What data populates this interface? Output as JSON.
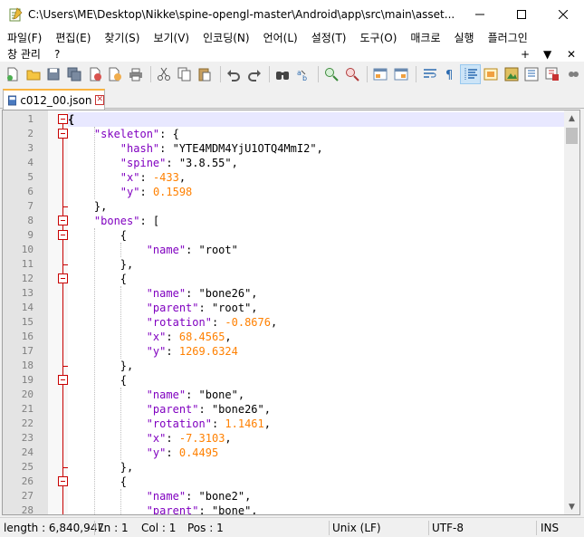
{
  "window": {
    "title": "C:\\Users\\ME\\Desktop\\Nikke\\spine-opengl-master\\Android\\app\\src\\main\\asset..."
  },
  "menu": {
    "row1": [
      "파일(F)",
      "편집(E)",
      "찾기(S)",
      "보기(V)",
      "인코딩(N)",
      "언어(L)",
      "설정(T)",
      "도구(O)",
      "매크로",
      "실행",
      "플러그인"
    ],
    "row2": [
      "창 관리",
      "?"
    ],
    "right_controls": [
      "+",
      "▼",
      "✕"
    ]
  },
  "toolbar": {
    "buttons": [
      "new-file",
      "open-file",
      "save",
      "save-all",
      "close",
      "close-all",
      "print",
      "cut",
      "copy",
      "paste",
      "undo",
      "redo",
      "find",
      "replace",
      "zoom-in",
      "zoom-out",
      "sync-vertical",
      "sync-horizontal",
      "word-wrap",
      "show-all-chars",
      "indent-guide",
      "document-map",
      "function-list",
      "folder-workspace",
      "monitoring"
    ]
  },
  "tab": {
    "label": "c012_00.json"
  },
  "editor": {
    "lines": [
      {
        "n": "1",
        "t": [
          [
            "p",
            "{"
          ]
        ]
      },
      {
        "n": "2",
        "t": [
          [
            "s",
            "    "
          ],
          [
            "k",
            "\"skeleton\""
          ],
          [
            "s",
            ": {"
          ]
        ]
      },
      {
        "n": "3",
        "t": [
          [
            "s",
            "        "
          ],
          [
            "k",
            "\"hash\""
          ],
          [
            "s",
            ": \"YTE4MDM4YjU1OTQ4MmI2\","
          ]
        ]
      },
      {
        "n": "4",
        "t": [
          [
            "s",
            "        "
          ],
          [
            "k",
            "\"spine\""
          ],
          [
            "s",
            ": \"3.8.55\","
          ]
        ]
      },
      {
        "n": "5",
        "t": [
          [
            "s",
            "        "
          ],
          [
            "k",
            "\"x\""
          ],
          [
            "s",
            ": "
          ],
          [
            "n",
            "-433"
          ],
          [
            "s",
            ","
          ]
        ]
      },
      {
        "n": "6",
        "t": [
          [
            "s",
            "        "
          ],
          [
            "k",
            "\"y\""
          ],
          [
            "s",
            ": "
          ],
          [
            "n",
            "0.1598"
          ]
        ]
      },
      {
        "n": "7",
        "t": [
          [
            "s",
            "    },"
          ]
        ]
      },
      {
        "n": "8",
        "t": [
          [
            "s",
            "    "
          ],
          [
            "k",
            "\"bones\""
          ],
          [
            "s",
            ": ["
          ]
        ]
      },
      {
        "n": "9",
        "t": [
          [
            "s",
            "        {"
          ]
        ]
      },
      {
        "n": "10",
        "t": [
          [
            "s",
            "            "
          ],
          [
            "k",
            "\"name\""
          ],
          [
            "s",
            ": \"root\""
          ]
        ]
      },
      {
        "n": "11",
        "t": [
          [
            "s",
            "        },"
          ]
        ]
      },
      {
        "n": "12",
        "t": [
          [
            "s",
            "        {"
          ]
        ]
      },
      {
        "n": "13",
        "t": [
          [
            "s",
            "            "
          ],
          [
            "k",
            "\"name\""
          ],
          [
            "s",
            ": \"bone26\","
          ]
        ]
      },
      {
        "n": "14",
        "t": [
          [
            "s",
            "            "
          ],
          [
            "k",
            "\"parent\""
          ],
          [
            "s",
            ": \"root\","
          ]
        ]
      },
      {
        "n": "15",
        "t": [
          [
            "s",
            "            "
          ],
          [
            "k",
            "\"rotation\""
          ],
          [
            "s",
            ": "
          ],
          [
            "n",
            "-0.8676"
          ],
          [
            "s",
            ","
          ]
        ]
      },
      {
        "n": "16",
        "t": [
          [
            "s",
            "            "
          ],
          [
            "k",
            "\"x\""
          ],
          [
            "s",
            ": "
          ],
          [
            "n",
            "68.4565"
          ],
          [
            "s",
            ","
          ]
        ]
      },
      {
        "n": "17",
        "t": [
          [
            "s",
            "            "
          ],
          [
            "k",
            "\"y\""
          ],
          [
            "s",
            ": "
          ],
          [
            "n",
            "1269.6324"
          ]
        ]
      },
      {
        "n": "18",
        "t": [
          [
            "s",
            "        },"
          ]
        ]
      },
      {
        "n": "19",
        "t": [
          [
            "s",
            "        {"
          ]
        ]
      },
      {
        "n": "20",
        "t": [
          [
            "s",
            "            "
          ],
          [
            "k",
            "\"name\""
          ],
          [
            "s",
            ": \"bone\","
          ]
        ]
      },
      {
        "n": "21",
        "t": [
          [
            "s",
            "            "
          ],
          [
            "k",
            "\"parent\""
          ],
          [
            "s",
            ": \"bone26\","
          ]
        ]
      },
      {
        "n": "22",
        "t": [
          [
            "s",
            "            "
          ],
          [
            "k",
            "\"rotation\""
          ],
          [
            "s",
            ": "
          ],
          [
            "n",
            "1.1461"
          ],
          [
            "s",
            ","
          ]
        ]
      },
      {
        "n": "23",
        "t": [
          [
            "s",
            "            "
          ],
          [
            "k",
            "\"x\""
          ],
          [
            "s",
            ": "
          ],
          [
            "n",
            "-7.3103"
          ],
          [
            "s",
            ","
          ]
        ]
      },
      {
        "n": "24",
        "t": [
          [
            "s",
            "            "
          ],
          [
            "k",
            "\"y\""
          ],
          [
            "s",
            ": "
          ],
          [
            "n",
            "0.4495"
          ]
        ]
      },
      {
        "n": "25",
        "t": [
          [
            "s",
            "        },"
          ]
        ]
      },
      {
        "n": "26",
        "t": [
          [
            "s",
            "        {"
          ]
        ]
      },
      {
        "n": "27",
        "t": [
          [
            "s",
            "            "
          ],
          [
            "k",
            "\"name\""
          ],
          [
            "s",
            ": \"bone2\","
          ]
        ]
      },
      {
        "n": "28",
        "t": [
          [
            "s",
            "            "
          ],
          [
            "k",
            "\"parent\""
          ],
          [
            "s",
            ": \"bone\","
          ]
        ]
      }
    ],
    "fold_lines": [
      1,
      2,
      8,
      9,
      12,
      19,
      26
    ]
  },
  "status": {
    "length": "length : 6,840,947",
    "ln": "Ln : 1",
    "col": "Col : 1",
    "pos": "Pos : 1",
    "eol": "Unix (LF)",
    "encoding": "UTF-8",
    "mode": "INS"
  }
}
